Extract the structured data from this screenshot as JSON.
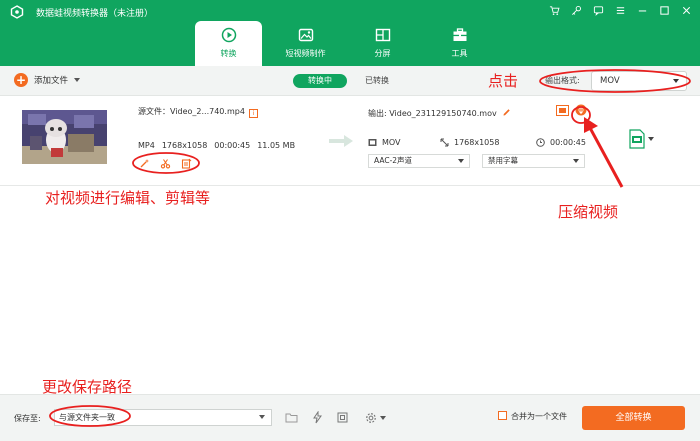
{
  "app": {
    "title": "数据蛙视频转换器（未注册）"
  },
  "tabs": [
    {
      "label": "转换",
      "icon": "convert-icon",
      "active": true
    },
    {
      "label": "短视频制作",
      "icon": "short-video-icon",
      "active": false
    },
    {
      "label": "分屏",
      "icon": "split-screen-icon",
      "active": false
    },
    {
      "label": "工具",
      "icon": "toolbox-icon",
      "active": false
    }
  ],
  "toolbar": {
    "add_file": "添加文件",
    "converting": "转换中",
    "converted": "已转换",
    "format_label": "输出格式:",
    "format_value": "MOV"
  },
  "file": {
    "source_name": "源文件：Video_2...740.mp4",
    "format": "MP4",
    "resolution": "1768x1058",
    "duration": "00:00:45",
    "size": "11.05 MB",
    "output_name": "输出: Video_231129150740.mov",
    "output_format": "MOV",
    "output_resolution": "1768x1058",
    "output_duration": "00:00:45",
    "audio": "AAC-2声道",
    "subtitle": "禁用字幕"
  },
  "footer": {
    "save_label": "保存至:",
    "save_path": "与源文件夹一致",
    "merge_label": "合并为一个文件",
    "convert_all": "全部转换"
  },
  "annotations": {
    "click": "点击",
    "edit": "对视频进行编辑、剪辑等",
    "compress": "压缩视频",
    "path": "更改保存路径"
  },
  "colors": {
    "brand": "#10a55f",
    "accent": "#f36b21",
    "annotation": "#e8201f"
  }
}
